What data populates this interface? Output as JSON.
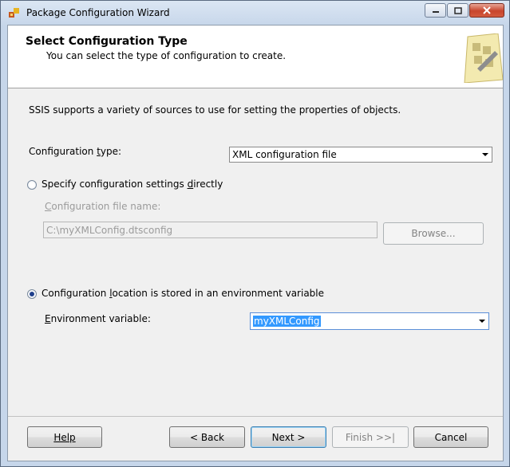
{
  "window": {
    "title": "Package Configuration Wizard"
  },
  "header": {
    "title": "Select Configuration Type",
    "subtitle": "You can select the type of configuration to create."
  },
  "description": "SSIS supports a variety of sources to use for setting the properties of objects.",
  "config_type": {
    "label_pre": "Configuration ",
    "label_accel": "t",
    "label_post": "ype:",
    "value": "XML configuration file"
  },
  "option_direct": {
    "label_pre": "Specify configuration settings ",
    "label_accel": "d",
    "label_post": "irectly",
    "selected": false,
    "file_label_accel": "C",
    "file_label_post": "onfiguration file name:",
    "file_value": "C:\\myXMLConfig.dtsconfig",
    "browse_label": "Browse..."
  },
  "option_env": {
    "label_pre": "Configuration ",
    "label_accel": "l",
    "label_post": "ocation is stored in an environment variable",
    "selected": true,
    "env_label_accel": "E",
    "env_label_post": "nvironment variable:",
    "env_value": "myXMLConfig"
  },
  "buttons": {
    "help": "Help",
    "back": "< Back",
    "next": "Next >",
    "finish": "Finish >>|",
    "cancel": "Cancel"
  }
}
